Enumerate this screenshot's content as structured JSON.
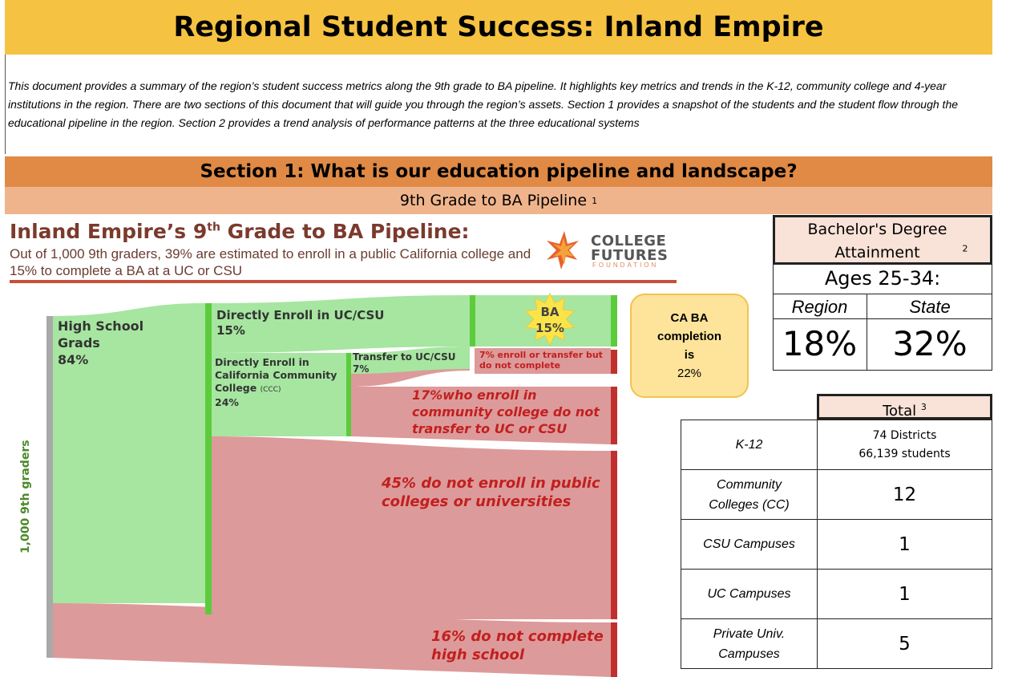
{
  "title": "Regional Student Success: Inland Empire",
  "intro": "This document provides a summary of the region’s student success metrics along the 9th grade to BA pipeline. It highlights key metrics and trends in the K-12, community college and 4-year institutions in the region. There are two sections of this document that will guide you through the region’s assets. Section 1 provides a snapshot of the students and the student flow through the educational pipeline in the region. Section 2 provides a trend analysis of performance patterns at the three educational systems",
  "section1": {
    "heading": "Section 1: What is our education pipeline and landscape?",
    "subheading": "9th Grade to BA Pipeline",
    "subheading_note": "1"
  },
  "pipeline": {
    "title_pre": "Inland Empire’s 9",
    "title_sup": "th",
    "title_post": " Grade to BA Pipeline:",
    "subtitle": "Out of 1,000 9th graders, 39% are estimated to enroll in a public California college and 15% to complete a BA at a UC or CSU",
    "logo": {
      "line1": "COLLEGE",
      "line2": "FUTURES",
      "line3": "FOUNDATION"
    },
    "axis_label": "1,000 9th graders",
    "hs_grads": {
      "label": "High School Grads",
      "pct": "84%"
    },
    "direct_ucsu": {
      "label": "Directly Enroll in UC/CSU",
      "pct": "15%"
    },
    "direct_ccc": {
      "label": "Directly Enroll in California Community College",
      "abbr": "(CCC)",
      "pct": "24%"
    },
    "transfer": {
      "label": "Transfer to UC/CSU",
      "pct": "7%"
    },
    "ba": {
      "label": "BA",
      "pct": "15%"
    },
    "not_complete_7": "7% enroll or transfer but do not complete",
    "no_transfer_17": "17%who enroll in community college do not transfer to UC or CSU",
    "not_enroll_45": "45% do not enroll in public colleges or universities",
    "not_complete_hs_16": "16% do not complete high school",
    "ca_ba": {
      "line1": "CA BA",
      "line2": "completion",
      "line3": "is",
      "value": "22%"
    }
  },
  "attainment": {
    "header": "Bachelor's Degree Attainment",
    "header_note": "2",
    "ages": "Ages 25-34:",
    "region_label": "Region",
    "state_label": "State",
    "region_value": "18%",
    "state_value": "32%"
  },
  "counts": {
    "total_header": "Total",
    "total_note": "3",
    "rows": [
      {
        "label": "K-12",
        "value_line1": "74 Districts",
        "value_line2": "66,139 students"
      },
      {
        "label": "Community Colleges (CC)",
        "value": "12"
      },
      {
        "label": "CSU Campuses",
        "value": "1"
      },
      {
        "label": "UC Campuses",
        "value": "1"
      },
      {
        "label": "Private Univ. Campuses",
        "value": "5"
      }
    ]
  },
  "colors": {
    "title_bg": "#f5c242",
    "section_bg": "#e08a45",
    "subsection_bg": "#f0b48c",
    "flow_green": "#a6e6a0",
    "node_green": "#5ccc3c",
    "flow_red": "#dd9a9a",
    "node_red": "#c0302e",
    "text_red": "#c21f1f"
  }
}
